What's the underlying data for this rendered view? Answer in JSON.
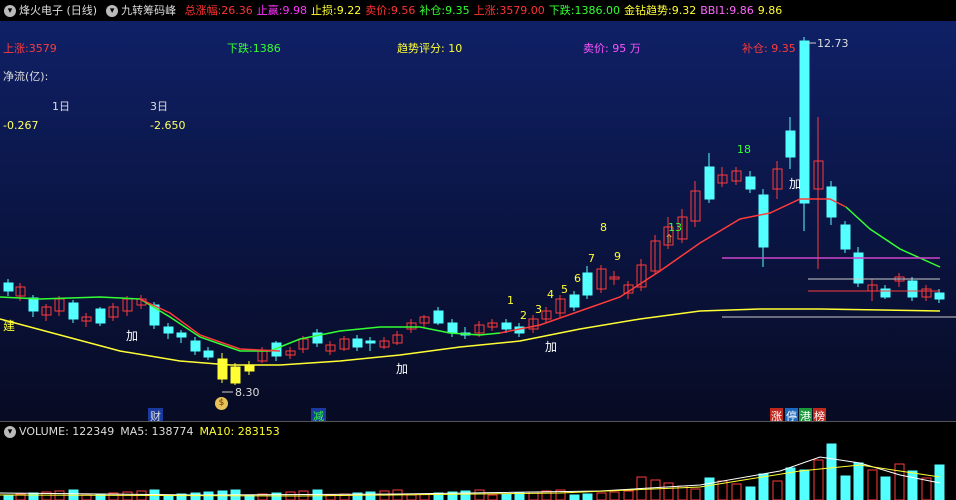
{
  "header": {
    "stock": "烽火电子 (日线)",
    "indicator": "九转筹码峰",
    "metrics": [
      {
        "label": "总涨幅:",
        "value": "26.36",
        "color": "#ff3333"
      },
      {
        "label": "止赢:",
        "value": "9.98",
        "color": "#ff33ff"
      },
      {
        "label": "止损:",
        "value": "9.22",
        "color": "#ffff33"
      },
      {
        "label": "卖价:",
        "value": "9.56",
        "color": "#ff3333"
      },
      {
        "label": "补仓:",
        "value": "9.35",
        "color": "#33ff33"
      },
      {
        "label": "上涨:",
        "value": "3579.00",
        "color": "#ff3333"
      },
      {
        "label": "下跌:",
        "value": "1386.00",
        "color": "#33ff33"
      },
      {
        "label": "金钻趋势:",
        "value": "9.32",
        "color": "#ffff33"
      },
      {
        "label": "BBI1:",
        "value": "9.86",
        "color": "#ff66ff"
      },
      {
        "label": "",
        "value": "9.86",
        "color": "#ffff33"
      }
    ]
  },
  "overlay": {
    "up": "上涨:3579",
    "down": "下跌:1386",
    "trend": "趋势评分:  10",
    "sell": "卖价: 95 万",
    "add": "补仓: 9.35",
    "netflow": "净流(亿):",
    "d1": "1日",
    "d3": "3日",
    "v1": "-0.267",
    "v3": "-2.650"
  },
  "price_labels": {
    "high": "12.73",
    "low": "8.30"
  },
  "markers": {
    "build": "建",
    "add": "加",
    "cai": "财",
    "jian": "减",
    "limit": [
      "涨",
      "停",
      "港",
      "榜"
    ]
  },
  "seq_upper": [
    "1",
    "2",
    "3",
    "4",
    "5",
    "6",
    "7",
    "8",
    "9"
  ],
  "seq_extra": [
    "13",
    "18"
  ],
  "volume": {
    "label": "VOLUME: 122349",
    "ma5": "MA5: 138774",
    "ma10": "MA10: 283153"
  },
  "colors": {
    "up": "#ff3b3b",
    "down": "#54ffff",
    "green": "#33ff33",
    "yellow": "#ffff33",
    "magenta": "#ff55ff"
  }
}
